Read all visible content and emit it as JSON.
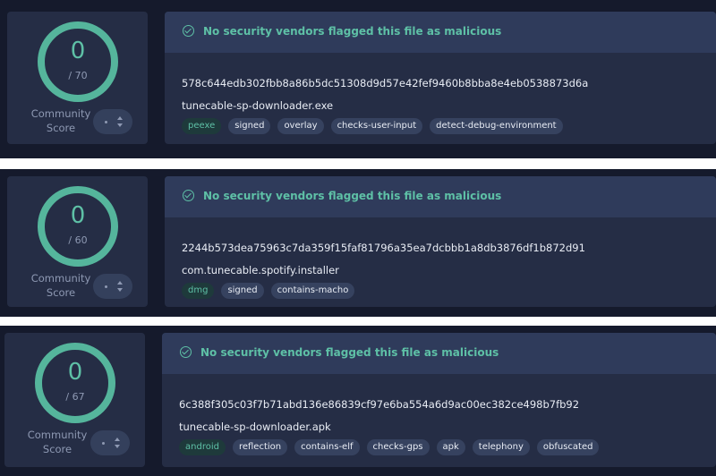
{
  "colors": {
    "accent": "#5ec0a6",
    "page_bg": "#151a2c",
    "card_bg": "#252d45",
    "header_bg": "#2f3b5b",
    "tag_bg": "#36425f"
  },
  "reports": [
    {
      "score": {
        "detections": "0",
        "total": "/ 70",
        "community_label_1": "Community",
        "community_label_2": "Score"
      },
      "status_text": "No security vendors flagged this file as malicious",
      "hash": "578c644edb302fbb8a86b5dc51308d9d57e42fef9460b8bba8e4eb0538873d6a",
      "filename": "tunecable-sp-downloader.exe",
      "tags": [
        "peexe",
        "signed",
        "overlay",
        "checks-user-input",
        "detect-debug-environment"
      ]
    },
    {
      "score": {
        "detections": "0",
        "total": "/ 60",
        "community_label_1": "Community",
        "community_label_2": "Score"
      },
      "status_text": "No security vendors flagged this file as malicious",
      "hash": "2244b573dea75963c7da359f15faf81796a35ea7dcbbb1a8db3876df1b872d91",
      "filename": "com.tunecable.spotify.installer",
      "tags": [
        "dmg",
        "signed",
        "contains-macho"
      ]
    },
    {
      "score": {
        "detections": "0",
        "total": "/ 67",
        "community_label_1": "Community",
        "community_label_2": "Score"
      },
      "status_text": "No security vendors flagged this file as malicious",
      "hash": "6c388f305c03f7b71abd136e86839cf97e6ba554a6d9ac00ec382ce498b7fb92",
      "filename": "tunecable-sp-downloader.apk",
      "tags": [
        "android",
        "reflection",
        "contains-elf",
        "checks-gps",
        "apk",
        "telephony",
        "obfuscated"
      ]
    }
  ]
}
